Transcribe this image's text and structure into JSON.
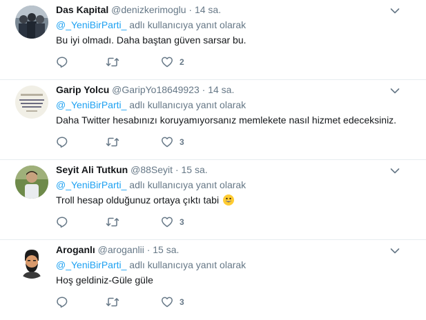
{
  "tweets": [
    {
      "name": "Das Kapital",
      "handle": "@denizkerimoglu",
      "dot": "·",
      "time": "14 sa.",
      "mention": "@_YeniBirParti_",
      "reply_suffix": " adlı kullanıcıya yanıt olarak",
      "text": "Bu iyi olmadı. Daha baştan güven sarsar bu.",
      "likes": "2"
    },
    {
      "name": "Garip Yolcu",
      "handle": "@GaripYo18649923",
      "dot": "·",
      "time": "14 sa.",
      "mention": "@_YeniBirParti_",
      "reply_suffix": " adlı kullanıcıya yanıt olarak",
      "text": "Daha Twitter hesabınızı koruyamıyorsanız memlekete nasıl hizmet edeceksiniz.",
      "likes": "3"
    },
    {
      "name": "Seyit Ali Tutkun",
      "handle": "@88Seyit",
      "dot": "·",
      "time": "15 sa.",
      "mention": "@_YeniBirParti_",
      "reply_suffix": " adlı kullanıcıya yanıt olarak",
      "text": "Troll hesap olduğunuz ortaya çıktı tabi",
      "likes": "3"
    },
    {
      "name": "Aroganlı",
      "handle": "@aroganlii",
      "dot": "·",
      "time": "15 sa.",
      "mention": "@_YeniBirParti_",
      "reply_suffix": " adlı kullanıcıya yanıt olarak",
      "text": "Hoş geldiniz-Güle güle",
      "likes": "3"
    }
  ],
  "icons": {
    "reply": "reply-icon",
    "retweet": "retweet-icon",
    "like": "heart-icon",
    "caret": "chevron-down-icon",
    "emoji": "grinning-face-emoji"
  },
  "colors": {
    "mention": "#1da1f2",
    "muted": "#657786",
    "text": "#14171a"
  }
}
